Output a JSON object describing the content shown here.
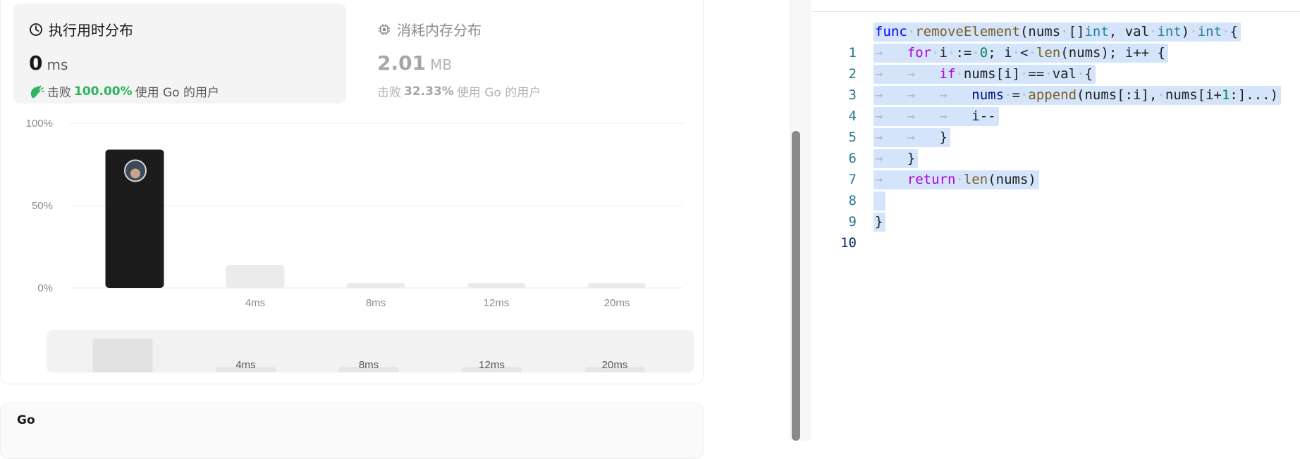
{
  "runtime_card": {
    "title": "执行用时分布",
    "value": "0",
    "unit": "ms",
    "beat_prefix": "击败",
    "beat_percent": "100.00%",
    "beat_suffix": "使用 Go 的用户"
  },
  "memory_card": {
    "title": "消耗内存分布",
    "value": "2.01",
    "unit": "MB",
    "beat_prefix": "击败",
    "beat_percent": "32.33%",
    "beat_suffix": "使用 Go 的用户"
  },
  "chart_data": {
    "type": "bar",
    "categories": [
      "",
      "4ms",
      "8ms",
      "12ms",
      "20ms"
    ],
    "values": [
      84,
      14,
      3,
      3,
      3
    ],
    "y_ticks": [
      "100%",
      "50%",
      "0%"
    ],
    "ylim": [
      0,
      100
    ],
    "highlight_index": 0,
    "grid": true,
    "colors": {
      "highlight": "#1c1c1c",
      "bar": "#ebebeb",
      "grid": "#ebebeb"
    }
  },
  "mini_chart": {
    "categories": [
      "",
      "4ms",
      "8ms",
      "12ms",
      "20ms"
    ],
    "values": [
      84,
      14,
      3,
      3,
      3
    ]
  },
  "language_section": {
    "label": "Go"
  },
  "editor": {
    "lines": [
      {
        "n": "1"
      },
      {
        "n": "2"
      },
      {
        "n": "3"
      },
      {
        "n": "4"
      },
      {
        "n": "5"
      },
      {
        "n": "6"
      },
      {
        "n": "7"
      },
      {
        "n": "8"
      },
      {
        "n": "9"
      },
      {
        "n": "10"
      }
    ],
    "tokens": {
      "l1": [
        "func",
        "removeElement",
        "(nums",
        "[]",
        "int",
        ", val",
        "int",
        ")",
        "int",
        "{"
      ],
      "l2": [
        "for",
        "i",
        ":=",
        "0",
        "; i",
        "<",
        "len",
        "(nums); i++ {"
      ],
      "l3": [
        "if",
        "nums[i]",
        "==",
        "val",
        "{"
      ],
      "l4": [
        "nums",
        "=",
        "append",
        "(nums[:i],",
        "nums[i+",
        "1",
        ":]...)"
      ],
      "l5": [
        "i--"
      ],
      "l6": [
        "}"
      ],
      "l7": [
        "}"
      ],
      "l8": [
        "return",
        "len",
        "(nums)"
      ],
      "l10": [
        "}"
      ]
    }
  }
}
